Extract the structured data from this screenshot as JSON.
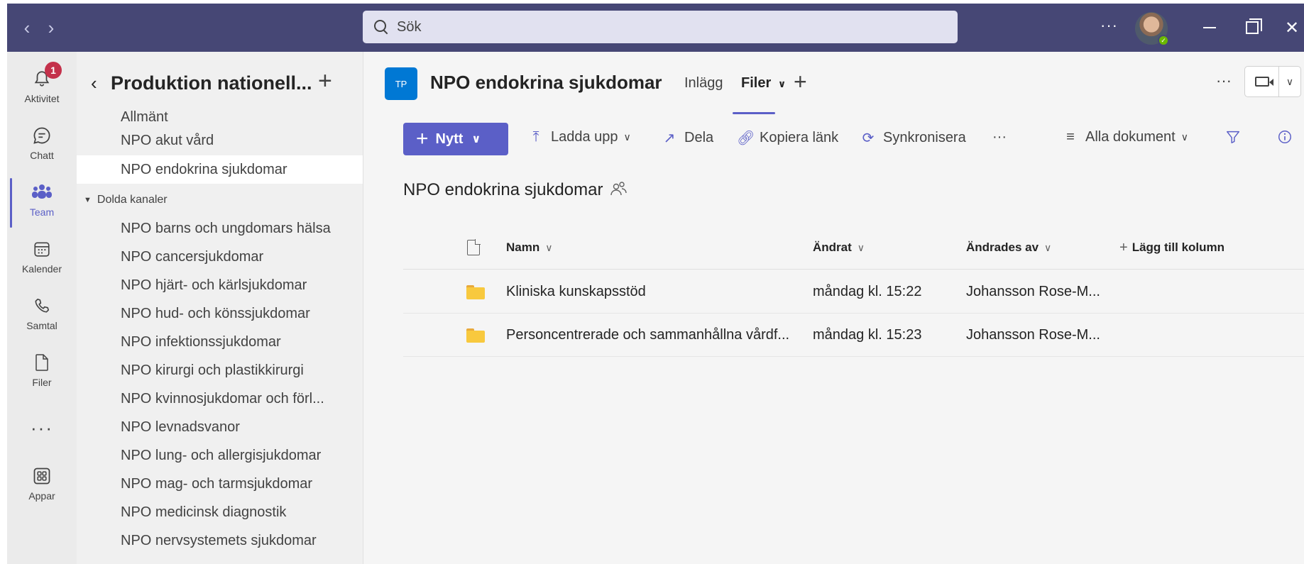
{
  "search": {
    "placeholder": "Sök"
  },
  "rail": {
    "items": [
      {
        "label": "Aktivitet",
        "badge": "1"
      },
      {
        "label": "Chatt"
      },
      {
        "label": "Team"
      },
      {
        "label": "Kalender"
      },
      {
        "label": "Samtal"
      },
      {
        "label": "Filer"
      },
      {
        "label": "Appar"
      }
    ],
    "more": "···"
  },
  "sidebar": {
    "team_title": "Produktion nationell...",
    "channels": [
      "Allmänt",
      "NPO akut vård",
      "NPO endokrina sjukdomar"
    ],
    "hidden_section": "Dolda kanaler",
    "hidden_channels": [
      "NPO barns och ungdomars hälsa",
      "NPO cancersjukdomar",
      "NPO hjärt- och kärlsjukdomar",
      "NPO hud- och könssjukdomar",
      "NPO infektionssjukdomar",
      "NPO kirurgi och plastikkirurgi",
      "NPO kvinnosjukdomar och förl...",
      "NPO levnadsvanor",
      "NPO lung- och allergisjukdomar",
      "NPO mag- och tarmsjukdomar",
      "NPO medicinsk diagnostik",
      "NPO nervsystemets sjukdomar"
    ]
  },
  "channel": {
    "avatar_initials": "TP",
    "title": "NPO endokrina sjukdomar",
    "tabs": [
      "Inlägg",
      "Filer"
    ],
    "active_tab": "Filer"
  },
  "commands": {
    "new": "Nytt",
    "upload": "Ladda upp",
    "share": "Dela",
    "copy_link": "Kopiera länk",
    "sync": "Synkronisera",
    "more": "···",
    "view": "Alla dokument"
  },
  "library": {
    "title": "NPO endokrina sjukdomar",
    "columns": {
      "name": "Namn",
      "modified": "Ändrat",
      "modified_by": "Ändrades av",
      "add_column": "Lägg till kolumn"
    },
    "rows": [
      {
        "name": "Kliniska kunskapsstöd",
        "modified": "måndag kl. 15:22",
        "modified_by": "Johansson Rose-M..."
      },
      {
        "name": "Personcentrerade och sammanhållna vårdf...",
        "modified": "måndag kl. 15:23",
        "modified_by": "Johansson Rose-M..."
      }
    ]
  },
  "colors": {
    "titlebar": "#464775",
    "accent": "#5b5fc7",
    "badge": "#c4314b",
    "folder": "#f8c93e",
    "channel_avatar": "#0078d4"
  }
}
